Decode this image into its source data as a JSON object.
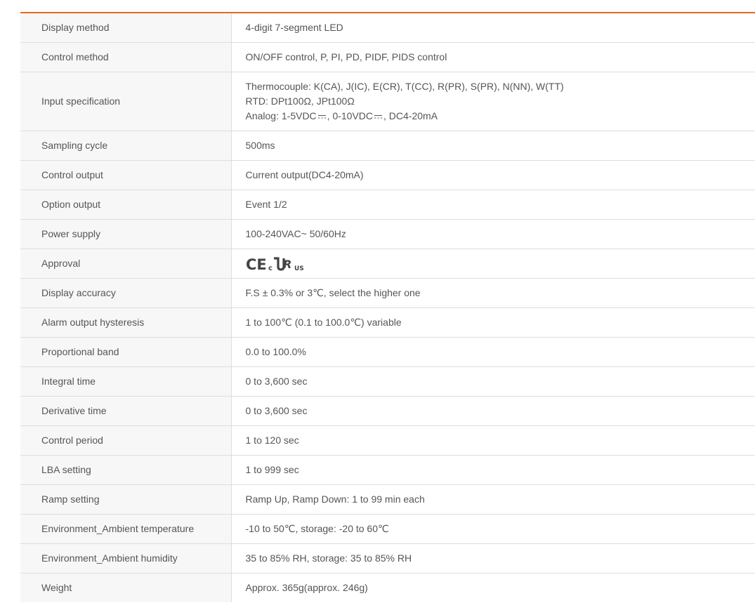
{
  "specs": [
    {
      "label": "Display method",
      "value": "4-digit 7-segment LED"
    },
    {
      "label": "Control method",
      "value": "ON/OFF control, P, PI, PD, PIDF, PIDS control"
    },
    {
      "label": "Input specification",
      "lines": {
        "thermocouple": "Thermocouple: K(CA), J(IC), E(CR), T(CC), R(PR), S(PR), N(NN), W(TT)",
        "rtd": "RTD: DPt100Ω, JPt100Ω",
        "analog_a": "Analog: 1-5VDC",
        "analog_b": ", 0-10VDC",
        "analog_c": ", DC4-20mA"
      }
    },
    {
      "label": "Sampling cycle",
      "value": "500ms"
    },
    {
      "label": "Control output",
      "value": "Current output(DC4-20mA)"
    },
    {
      "label": "Option output",
      "value": "Event 1/2"
    },
    {
      "label": "Power supply",
      "value": "100-240VAC~ 50/60Hz"
    },
    {
      "label": "Approval",
      "cert_marks": "CE and c-UR-us certification marks",
      "cert_text": {
        "ce": "CE",
        "c": "c",
        "ur": "R",
        "us": "US"
      }
    },
    {
      "label": "Display accuracy",
      "value": "F.S ± 0.3% or 3℃, select the higher one"
    },
    {
      "label": "Alarm output hysteresis",
      "value": "1 to 100℃ (0.1 to 100.0℃) variable"
    },
    {
      "label": "Proportional band",
      "value": "0.0 to 100.0%"
    },
    {
      "label": "Integral time",
      "value": "0 to 3,600 sec"
    },
    {
      "label": "Derivative time",
      "value": "0 to 3,600 sec"
    },
    {
      "label": "Control period",
      "value": "1 to 120 sec"
    },
    {
      "label": "LBA setting",
      "value": "1 to 999 sec"
    },
    {
      "label": "Ramp setting",
      "value": "Ramp Up, Ramp Down: 1 to 99 min each"
    },
    {
      "label": "Environment_Ambient temperature",
      "value": "-10 to 50℃, storage: -20 to 60℃"
    },
    {
      "label": "Environment_Ambient humidity",
      "value": "35 to 85% RH, storage: 35 to 85% RH"
    },
    {
      "label": "Weight",
      "value": "Approx. 365g(approx. 246g)"
    }
  ],
  "colors": {
    "accent": "#e8671c",
    "label_bg": "#f7f7f7",
    "border": "#dddddd",
    "text": "#555555"
  },
  "icons": {
    "dc": "dc-voltage-symbol-icon",
    "approval": "ce-cur-us-certification-icon"
  }
}
